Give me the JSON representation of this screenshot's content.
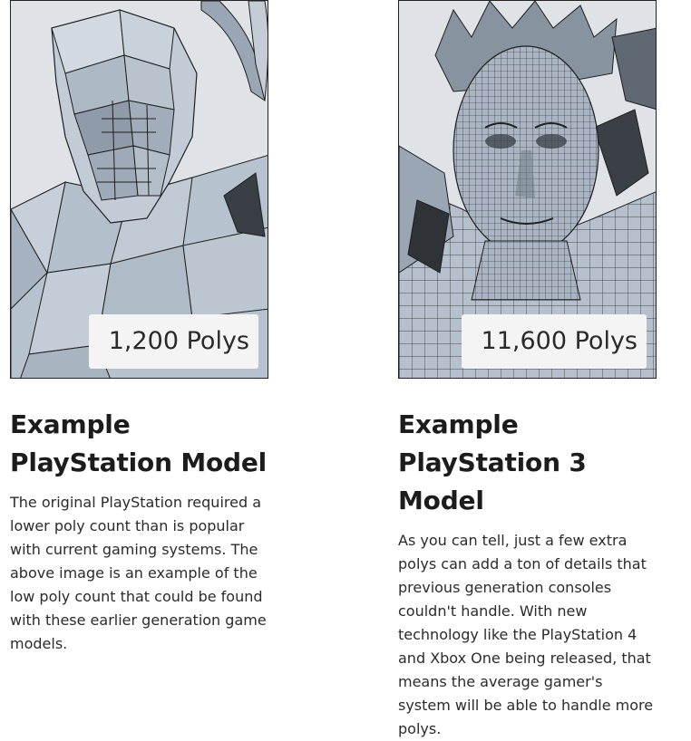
{
  "cards": [
    {
      "badge": "1,200 Polys",
      "title": "Example PlayStation Model",
      "description": "The original PlayStation required a lower poly count than is popular with current gaming systems. The above image is an example of the low poly count that could be found with these earlier generation game models."
    },
    {
      "badge": "11,600 Polys",
      "title": "Example PlayStation 3 Model",
      "description": "As you can tell, just a few extra polys can add a ton of details that previous generation consoles couldn't handle. With new technology like the PlayStation 4 and Xbox One being released, that means the average gamer's system will be able to handle more polys."
    }
  ],
  "colors": {
    "mesh_fill": "#b7c2cf",
    "mesh_shade": "#8e9aa8",
    "wire": "#1e1e1e",
    "background": "#dfe3e7"
  }
}
